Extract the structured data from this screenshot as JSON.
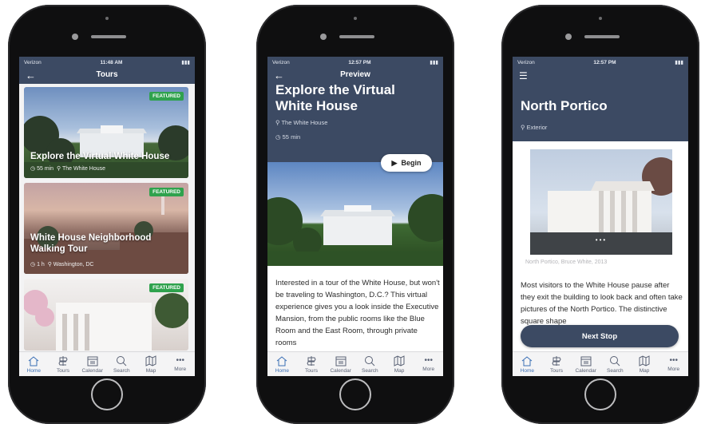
{
  "phone1": {
    "status": {
      "carrier": "Verizon",
      "time": "11:48 AM"
    },
    "nav_title": "Tours",
    "cards": [
      {
        "badge": "FEATURED",
        "title": "Explore the Virtual White House",
        "duration": "55 min",
        "location": "The White House"
      },
      {
        "badge": "FEATURED",
        "title": "White House Neighborhood Walking Tour",
        "duration": "1 h",
        "location": "Washington, DC"
      },
      {
        "badge": "FEATURED"
      }
    ],
    "tabs": [
      "Home",
      "Tours",
      "Calendar",
      "Search",
      "Map",
      "More"
    ]
  },
  "phone2": {
    "status": {
      "carrier": "Verizon",
      "time": "12:57 PM"
    },
    "nav_title": "Preview",
    "heading": "Explore the Virtual White House",
    "location": "The White House",
    "duration": "55 min",
    "begin_label": "Begin",
    "body": "Interested in a tour of the White House, but won't be traveling to Washington, D.C.? This virtual experience gives you a look inside the Executive Mansion, from the public rooms like the Blue Room and the East Room, through private rooms",
    "tabs": [
      "Home",
      "Tours",
      "Calendar",
      "Search",
      "Map",
      "More"
    ]
  },
  "phone3": {
    "status": {
      "carrier": "Verizon",
      "time": "12:57 PM"
    },
    "heading": "North Portico",
    "category": "Exterior",
    "caption": "North Portico, Bruce White, 2013",
    "body": "Most visitors to the White House pause after they exit the building to look back and often take pictures of the North Portico. The distinctive square shape",
    "next_label": "Next Stop",
    "tabs": [
      "Home",
      "Tours",
      "Calendar",
      "Search",
      "Map",
      "More"
    ]
  },
  "colors": {
    "nav": "#3c4a63",
    "featured": "#2fa24d",
    "active_tab": "#3a6fb5"
  }
}
